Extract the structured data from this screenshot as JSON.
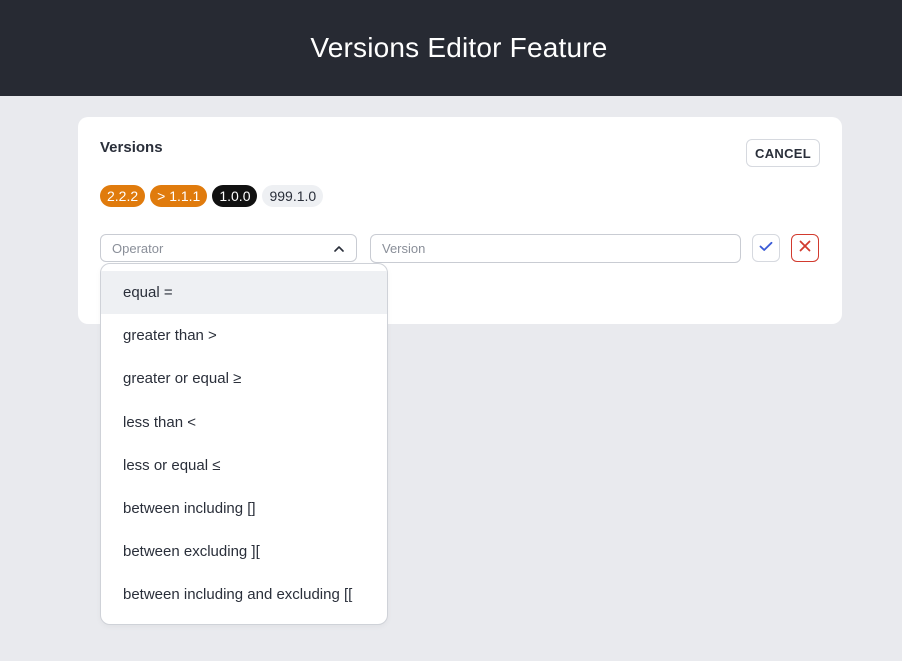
{
  "header": {
    "title": "Versions Editor Feature"
  },
  "card": {
    "title": "Versions",
    "cancel_label": "CANCEL",
    "badges": [
      {
        "label": "2.2.2",
        "style": "orange"
      },
      {
        "label": "> 1.1.1",
        "style": "orange"
      },
      {
        "label": "1.0.0",
        "style": "black"
      },
      {
        "label": "999.1.0",
        "style": "light"
      }
    ],
    "operator": {
      "placeholder": "Operator",
      "value": ""
    },
    "version": {
      "placeholder": "Version",
      "value": ""
    },
    "helper_hint_visible_fragment": "e"
  },
  "dropdown": {
    "options": [
      "equal =",
      "greater than >",
      "greater or equal ≥",
      "less than <",
      "less or equal ≤",
      "between including []",
      "between excluding ][",
      "between including and excluding [["
    ],
    "highlighted_index": 0
  },
  "colors": {
    "header_bg": "#272a33",
    "page_bg": "#e9eaee",
    "badge_orange": "#e07b0d",
    "badge_black": "#111111",
    "badge_light": "#eef0f3",
    "confirm_icon": "#3b5bd6",
    "remove_icon": "#d23a2e"
  },
  "icons": {
    "operator_toggle": "chevron-up-icon",
    "confirm": "check-icon",
    "remove": "close-icon"
  }
}
